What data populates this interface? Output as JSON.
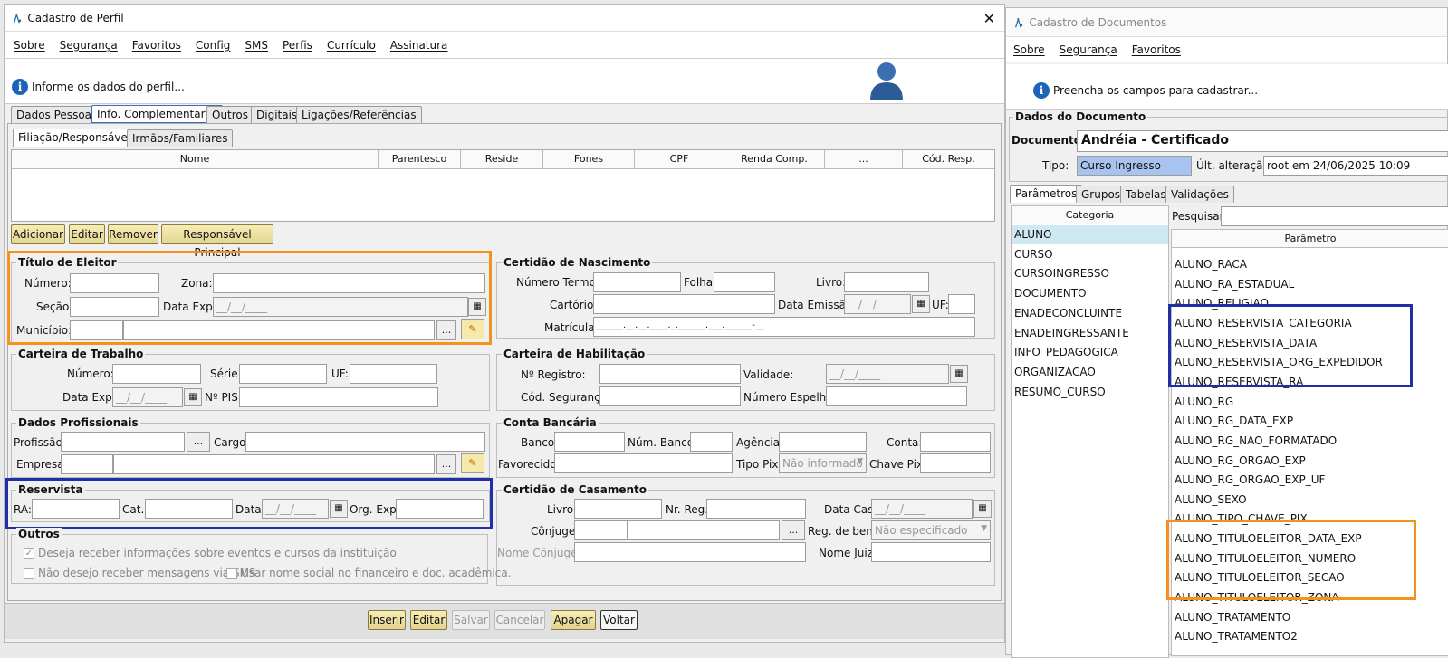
{
  "left": {
    "title": "Cadastro de Perfil",
    "menu": [
      "Sobre",
      "Segurança",
      "Favoritos",
      "Config",
      "SMS",
      "Perfis",
      "Currículo",
      "Assinatura"
    ],
    "info": "Informe os dados do perfil...",
    "tabs": [
      "Dados Pessoais",
      "Info. Complementares",
      "Outros",
      "Digitais",
      "Ligações/Referências"
    ],
    "subtabs": [
      "Filiação/Responsáveis",
      "Irmãos/Familiares"
    ],
    "table_headers": [
      "Nome",
      "Parentesco",
      "Reside",
      "Fones",
      "CPF",
      "Renda Comp.",
      "...",
      "Cód. Resp."
    ],
    "table_buttons": [
      "Adicionar",
      "Editar",
      "Remover",
      "Responsável Principal"
    ],
    "titulo": {
      "title": "Título de Eleitor",
      "numero": "Número:",
      "zona": "Zona:",
      "secao": "Seção:",
      "data_exp": "Data Exp.:",
      "date_mask": "__/__/____",
      "municipio": "Município:"
    },
    "certidao_nasc": {
      "title": "Certidão de Nascimento",
      "numero_termo": "Número Termo:",
      "folha": "Folha:",
      "livro": "Livro:",
      "cartorio": "Cartório:",
      "data_emissao": "Data Emissão:",
      "date_mask": "__/__/____",
      "uf": "UF:",
      "matricula": "Matrícula:",
      "matricula_mask": "______.__.__.____._.______.___.______-__"
    },
    "carteira": {
      "title": "Carteira de Trabalho",
      "numero": "Número:",
      "serie": "Série:",
      "uf": "UF:",
      "data_exp": "Data Exp.:",
      "date_mask": "__/__/____",
      "pis": "Nº PIS:"
    },
    "habilitacao": {
      "title": "Carteira de Habilitação",
      "registro": "Nº Registro:",
      "validade": "Validade:",
      "date_mask": "__/__/____",
      "cod_seg": "Cód. Segurança:",
      "espelho": "Número Espelho:"
    },
    "profissionais": {
      "title": "Dados Profissionais",
      "profissao": "Profissão:",
      "cargo": "Cargo:",
      "empresa": "Empresa:"
    },
    "bancaria": {
      "title": "Conta Bancária",
      "banco": "Banco:",
      "num_banco": "Núm. Banco:",
      "agencia": "Agência:",
      "conta": "Conta:",
      "favorecido": "Favorecido:",
      "tipo_pix": "Tipo Pix:",
      "tipo_pix_value": "Não informado",
      "chave_pix": "Chave Pix:"
    },
    "reservista": {
      "title": "Reservista",
      "ra": "RA:",
      "cat": "Cat.:",
      "data": "Data:",
      "date_mask": "__/__/____",
      "org": "Org. Exp.:"
    },
    "casamento": {
      "title": "Certidão de Casamento",
      "livro": "Livro:",
      "nr_reg": "Nr. Reg.:",
      "data_cas": "Data Cas.:",
      "date_mask": "__/__/____",
      "conjuge": "Cônjuge:",
      "reg_bens": "Reg. de bens:",
      "reg_bens_value": "Não especificado",
      "nome_conjuge": "Nome Cônjuge:",
      "nome_juiz": "Nome Juiz:"
    },
    "outros": {
      "title": "Outros",
      "chk1": "Deseja receber informações sobre eventos e cursos da instituição",
      "chk2": "Não desejo receber mensagens via SMS",
      "chk3": "Usar nome social no financeiro e doc. acadêmica."
    },
    "actions": [
      "Inserir",
      "Editar",
      "Salvar",
      "Cancelar",
      "Apagar",
      "Voltar"
    ]
  },
  "right": {
    "title": "Cadastro de Documentos",
    "menu": [
      "Sobre",
      "Segurança",
      "Favoritos"
    ],
    "info": "Preencha os campos para cadastrar...",
    "group": "Dados do Documento",
    "documento_label": "Documento:",
    "documento_value": "Andréia - Certificado",
    "tipo_label": "Tipo:",
    "tipo_value": "Curso Ingresso",
    "ult_label": "Últ. alteração:",
    "ult_value": "root em 24/06/2025 10:09",
    "tabs": [
      "Parâmetros",
      "Grupos",
      "Tabelas",
      "Validações"
    ],
    "categoria_header": "Categoria",
    "categorias": [
      "ALUNO",
      "CURSO",
      "CURSOINGRESSO",
      "DOCUMENTO",
      "ENADECONCLUINTE",
      "ENADEINGRESSANTE",
      "INFO_PEDAGOGICA",
      "ORGANIZACAO",
      "RESUMO_CURSO"
    ],
    "pesquisar": "Pesquisar:",
    "parametro_header": "Parâmetro",
    "parametros": [
      "ALUNO_RACA",
      "ALUNO_RA_ESTADUAL",
      "ALUNO_RELIGIAO",
      "ALUNO_RESERVISTA_CATEGORIA",
      "ALUNO_RESERVISTA_DATA",
      "ALUNO_RESERVISTA_ORG_EXPEDIDOR",
      "ALUNO_RESERVISTA_RA",
      "ALUNO_RG",
      "ALUNO_RG_DATA_EXP",
      "ALUNO_RG_NAO_FORMATADO",
      "ALUNO_RG_ORGAO_EXP",
      "ALUNO_RG_ORGAO_EXP_UF",
      "ALUNO_SEXO",
      "ALUNO_TIPO_CHAVE_PIX",
      "ALUNO_TITULOELEITOR_DATA_EXP",
      "ALUNO_TITULOELEITOR_NUMERO",
      "ALUNO_TITULOELEITOR_SECAO",
      "ALUNO_TITULOELEITOR_ZONA",
      "ALUNO_TRATAMENTO",
      "ALUNO_TRATAMENTO2"
    ]
  },
  "colors": {
    "highlight_orange": "#f5921e",
    "highlight_blue": "#1f2fa8",
    "button": "#e4d490"
  }
}
